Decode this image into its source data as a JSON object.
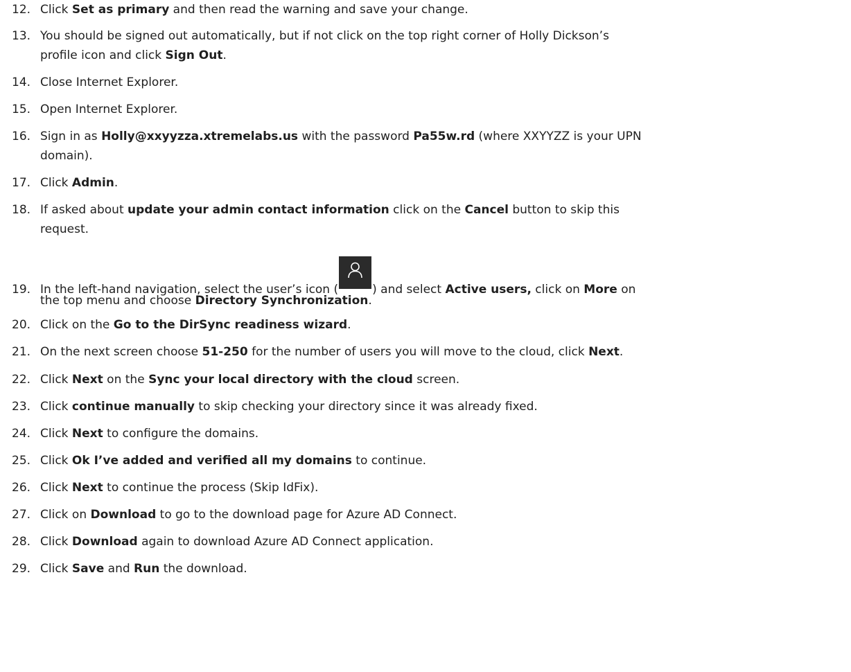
{
  "steps": [
    {
      "n": "12.",
      "a": "Click ",
      "b1": "Set as primary",
      "c": " and then read the warning and save your change."
    },
    {
      "n": "13.",
      "line1": "You should be signed out automatically, but if not click on the top right corner of Holly Dickson’s",
      "line2a": "profile icon and click ",
      "b1": "Sign Out",
      "line2c": "."
    },
    {
      "n": "14.",
      "a": "Close Internet Explorer."
    },
    {
      "n": "15.",
      "a": "Open Internet Explorer."
    },
    {
      "n": "16.",
      "a": "Sign in as ",
      "b1": "Holly@xxyyzza.xtremelabs.us",
      "c": " with the password ",
      "b2": "Pa55w.rd",
      "d": " (where XXYYZZ is your UPN",
      "line2": "domain)."
    },
    {
      "n": "17.",
      "a": "Click ",
      "b1": "Admin",
      "c": "."
    },
    {
      "n": "18.",
      "a": "If asked about ",
      "b1": "update your admin contact information",
      "c": " click on the ",
      "b2": "Cancel",
      "d": " button to skip this",
      "line2": "request."
    },
    {
      "n": "19.",
      "a": "In the left-hand navigation, select the user’s icon (",
      "icon": "user-icon",
      "c": ") and select ",
      "b1": "Active users,",
      "d": " click on ",
      "b2": "More",
      "e": " on",
      "line2a": "the top menu and choose ",
      "b3": "Directory Synchronization",
      "line2c": "."
    },
    {
      "n": "20.",
      "a": "Click on the ",
      "b1": "Go to the DirSync readiness wizard",
      "c": "."
    },
    {
      "n": "21.",
      "a": "On the next screen choose ",
      "b1": "51-250",
      "c": " for the number of users you will move to the cloud, click ",
      "b2": "Next",
      "d": "."
    },
    {
      "n": "22.",
      "a": "Click ",
      "b1": "Next",
      "c": " on the ",
      "b2": "Sync your local directory with the cloud",
      "d": " screen."
    },
    {
      "n": "23.",
      "a": "Click ",
      "b1": "continue manually",
      "c": " to skip checking your directory since it was already fixed."
    },
    {
      "n": "24.",
      "a": "Click ",
      "b1": "Next",
      "c": " to configure the domains."
    },
    {
      "n": "25.",
      "a": "Click ",
      "b1": "Ok I’ve added and verified all my domains",
      "c": " to continue."
    },
    {
      "n": "26.",
      "a": "Click ",
      "b1": "Next",
      "c": " to continue the process (Skip IdFix)."
    },
    {
      "n": "27.",
      "a": "Click on ",
      "b1": "Download",
      "c": " to go to the download page for Azure AD Connect."
    },
    {
      "n": "28.",
      "a": "Click ",
      "b1": "Download",
      "c": " again to download Azure AD Connect application."
    },
    {
      "n": "29.",
      "a": "Click ",
      "b1": "Save",
      "c": " and ",
      "b2": "Run",
      "d": " the download."
    }
  ],
  "colors": {
    "text": "#1f1f1f",
    "icon_bg": "#2b2b2b",
    "icon_fg": "#ffffff"
  }
}
